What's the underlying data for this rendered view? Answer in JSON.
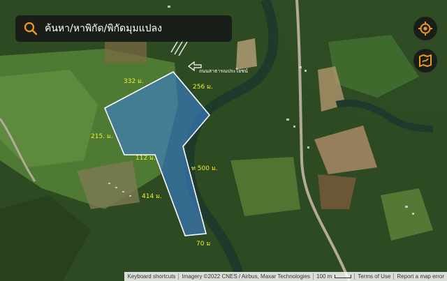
{
  "search": {
    "label": "ค้นหา/หาพิกัด/พิกัดมุมแปลง"
  },
  "road_label": "ถนนสาธารณประโยชน์",
  "plot_labels": {
    "top_left": "332 ม.",
    "top_right": "256 ม.",
    "left": "215. ม.",
    "inner_step": "112 ม.",
    "right": "ท 500 ม.",
    "bottom_left": "414 ม.",
    "bottom": "70 ม"
  },
  "attribution": {
    "shortcuts": "Keyboard shortcuts",
    "imagery": "Imagery ©2022 CNES / Airbus, Maxar Technologies",
    "scale": "100 m",
    "terms": "Terms of Use",
    "report": "Report a map error"
  },
  "colors": {
    "plot_fill": "#3a7fd0",
    "plot_stroke": "#ffffff",
    "label_yellow": "#f2ee2a",
    "accent_orange": "#f39a1e"
  },
  "icons": [
    "search-icon",
    "locate-icon",
    "map-layers-icon",
    "road-arrow-icon"
  ]
}
